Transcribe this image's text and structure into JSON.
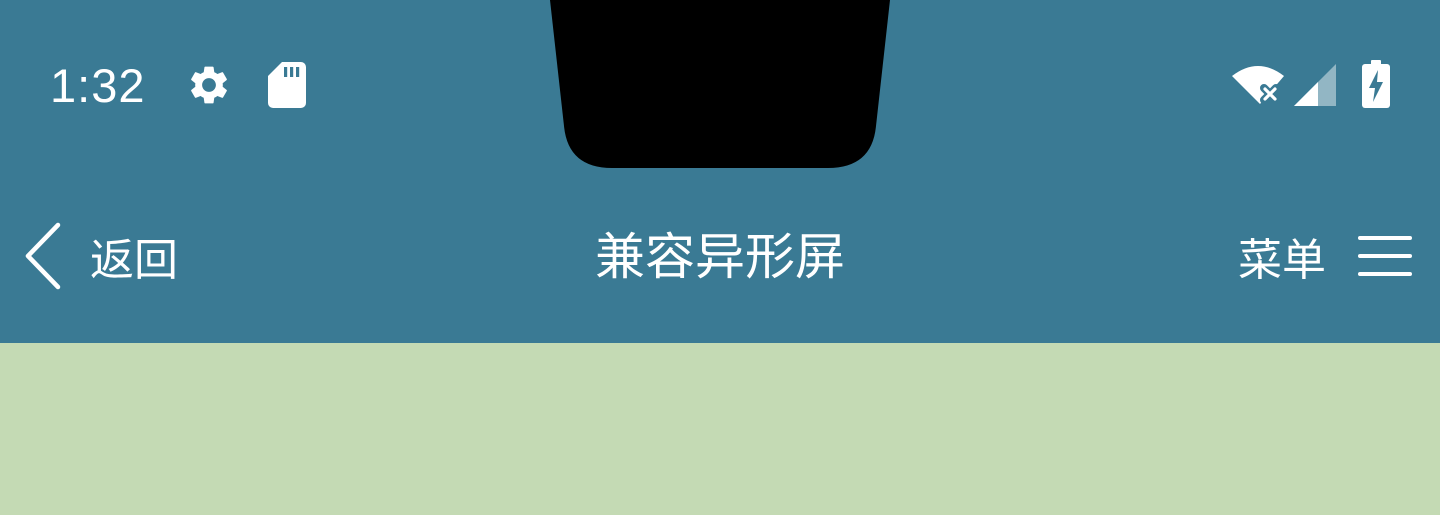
{
  "status_bar": {
    "time": "1:32",
    "left_icons": [
      "gear-icon",
      "sd-card-icon"
    ],
    "right_icons": [
      "wifi-off-icon",
      "cell-signal-icon",
      "battery-charging-icon"
    ]
  },
  "app_bar": {
    "back_label": "返回",
    "title": "兼容异形屏",
    "menu_label": "菜单"
  },
  "colors": {
    "app_bar_background": "#3a7a94",
    "content_background": "#c4dab4",
    "notch": "#000000",
    "foreground": "#ffffff"
  }
}
